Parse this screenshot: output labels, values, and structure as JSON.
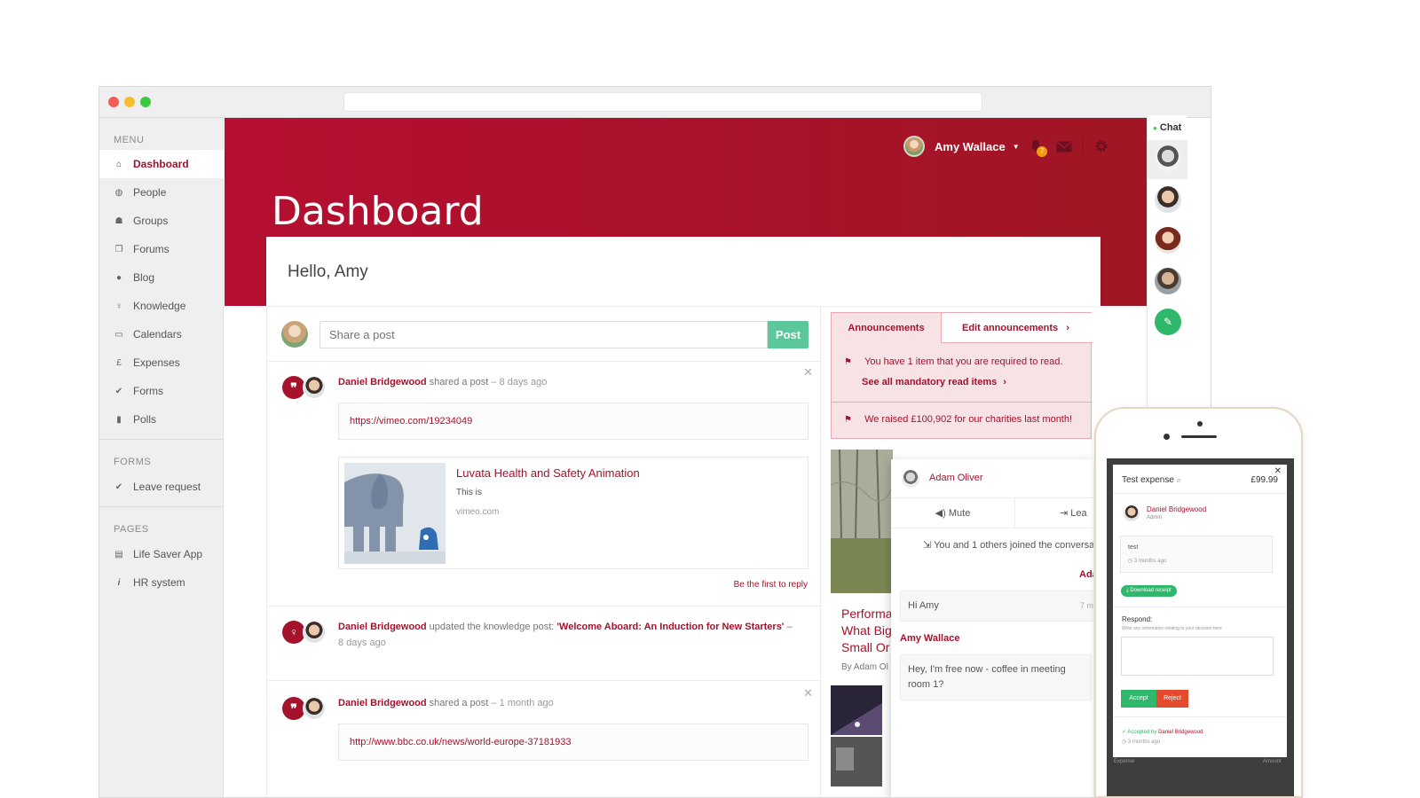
{
  "menu": {
    "section_label": "MENU",
    "items": [
      {
        "label": "Dashboard",
        "icon": "home-icon",
        "glyph": "⌂"
      },
      {
        "label": "People",
        "icon": "globe-icon",
        "glyph": "◍"
      },
      {
        "label": "Groups",
        "icon": "group-icon",
        "glyph": "☗"
      },
      {
        "label": "Forums",
        "icon": "forums-icon",
        "glyph": "❐"
      },
      {
        "label": "Blog",
        "icon": "blog-icon",
        "glyph": "●"
      },
      {
        "label": "Knowledge",
        "icon": "lightbulb-icon",
        "glyph": "♀"
      },
      {
        "label": "Calendars",
        "icon": "calendar-icon",
        "glyph": "▭"
      },
      {
        "label": "Expenses",
        "icon": "pound-icon",
        "glyph": "£"
      },
      {
        "label": "Forms",
        "icon": "check-circle-icon",
        "glyph": "✔"
      },
      {
        "label": "Polls",
        "icon": "bar-chart-icon",
        "glyph": "▮"
      }
    ]
  },
  "forms": {
    "section_label": "FORMS",
    "items": [
      {
        "label": "Leave request",
        "icon": "check-circle-icon",
        "glyph": "✔"
      }
    ]
  },
  "pages": {
    "section_label": "PAGES",
    "items": [
      {
        "label": "Life Saver App",
        "icon": "page-icon",
        "glyph": "▤"
      },
      {
        "label": "HR system",
        "icon": "info-icon",
        "glyph": "i"
      }
    ]
  },
  "header": {
    "title": "Dashboard",
    "user_name": "Amy Wallace",
    "notification_count": "7",
    "greeting": "Hello, Amy"
  },
  "share": {
    "placeholder": "Share a post",
    "post_label": "Post"
  },
  "feed": {
    "post1": {
      "author": "Daniel Bridgewood",
      "action": " shared a post",
      "time": " – 8 days ago",
      "link": "https://vimeo.com/19234049",
      "preview_title": "Luvata Health and Safety Animation",
      "preview_desc": "This is",
      "preview_host": "vimeo.com",
      "reply": "Be the first to reply"
    },
    "post2": {
      "author": "Daniel Bridgewood",
      "action": " updated the knowledge post: ",
      "target": "'Welcome Aboard: An Induction for New Starters'",
      "dash": " –",
      "time": "8 days ago"
    },
    "post3": {
      "author": "Daniel Bridgewood",
      "action": " shared a post",
      "time": " – 1 month ago",
      "link": "http://www.bbc.co.uk/news/world-europe-37181933"
    }
  },
  "announcements": {
    "tab_label": "Announcements",
    "edit_label": "Edit announcements",
    "line1": "You have 1 item that you are required to read.",
    "line1_link": "See all mandatory read items",
    "line2": "We raised £100,902 for our charities last month!"
  },
  "article": {
    "title": "Performa What Big Small Or",
    "by": "By Adam Ol"
  },
  "chat_popup": {
    "name": "Adam Oliver",
    "mute": "Mute",
    "leave": "Lea",
    "joined": "You and 1 others joined the conversa",
    "sender_right": "Ada",
    "msg1": "Hi Amy",
    "msg1_time": "7 m",
    "sender2": "Amy Wallace",
    "msg2": "Hey, I'm free now - coffee in meeting room 1?"
  },
  "chat_sidebar": {
    "label": "Chat"
  },
  "phone": {
    "title": "Test expense",
    "price": "£99.99",
    "author": "Daniel Bridgewood",
    "role": "Admin",
    "note": "test",
    "note_time": "3 months ago",
    "download": "Download receipt",
    "respond_label": "Respond:",
    "respond_hint": "Write any information relating to your decision here",
    "accept": "Accept",
    "reject": "Reject",
    "accepted_by": "Accepted by ",
    "accepted_name": "Daniel Bridgewood",
    "accepted_time": "3 months ago",
    "footer_left": "Expense",
    "footer_right": "Amount"
  },
  "colors": {
    "brand": "#a4122c",
    "accent_green": "#5cc79a",
    "reject": "#e64a2e"
  }
}
